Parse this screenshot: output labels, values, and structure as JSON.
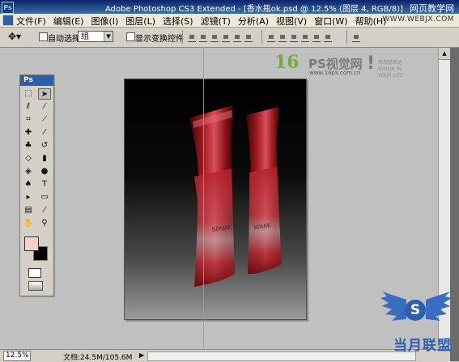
{
  "window": {
    "title": "Adobe Photoshop CS3 Extended - [香水瓶ok.psd @ 12.5% (图层 4, RGB/8)]",
    "watermark_site_text": "网页教学网"
  },
  "menubar": {
    "items": [
      "文件(F)",
      "编辑(E)",
      "图像(I)",
      "图层(L)",
      "选择(S)",
      "滤镜(T)",
      "分析(A)",
      "视图(V)",
      "窗口(W)",
      "帮助(H)"
    ],
    "site_url": "WWW.WEBJX.COM"
  },
  "options_bar": {
    "auto_select_label": "自动选择:",
    "auto_select_value": "组",
    "show_transform_label": "显示变换控件"
  },
  "toolbox": {
    "header": "Ps",
    "tools": [
      "marquee-icon",
      "move-icon",
      "lasso-icon",
      "magic-wand-icon",
      "crop-icon",
      "slice-icon",
      "healing-icon",
      "brush-icon",
      "stamp-icon",
      "history-brush-icon",
      "eraser-icon",
      "gradient-icon",
      "blur-icon",
      "dodge-icon",
      "pen-icon",
      "type-icon",
      "path-select-icon",
      "shape-icon",
      "notes-icon",
      "eyedropper-icon",
      "hand-icon",
      "zoom-icon"
    ],
    "colors": {
      "foreground": "#f2d0d0",
      "background": "#000000"
    }
  },
  "watermark_logo": {
    "number": "16",
    "brand": "PS视觉网",
    "url": "www.16ps.com.cn",
    "slogan_line1": "用视觉表达",
    "slogan_line2": "VISION IN YOUR LIFE"
  },
  "status_bar": {
    "zoom": "12.5%",
    "doc_info": "文档:24.5M/105.6M"
  },
  "site_logo": {
    "letter": "S",
    "text": "当月联盟"
  }
}
